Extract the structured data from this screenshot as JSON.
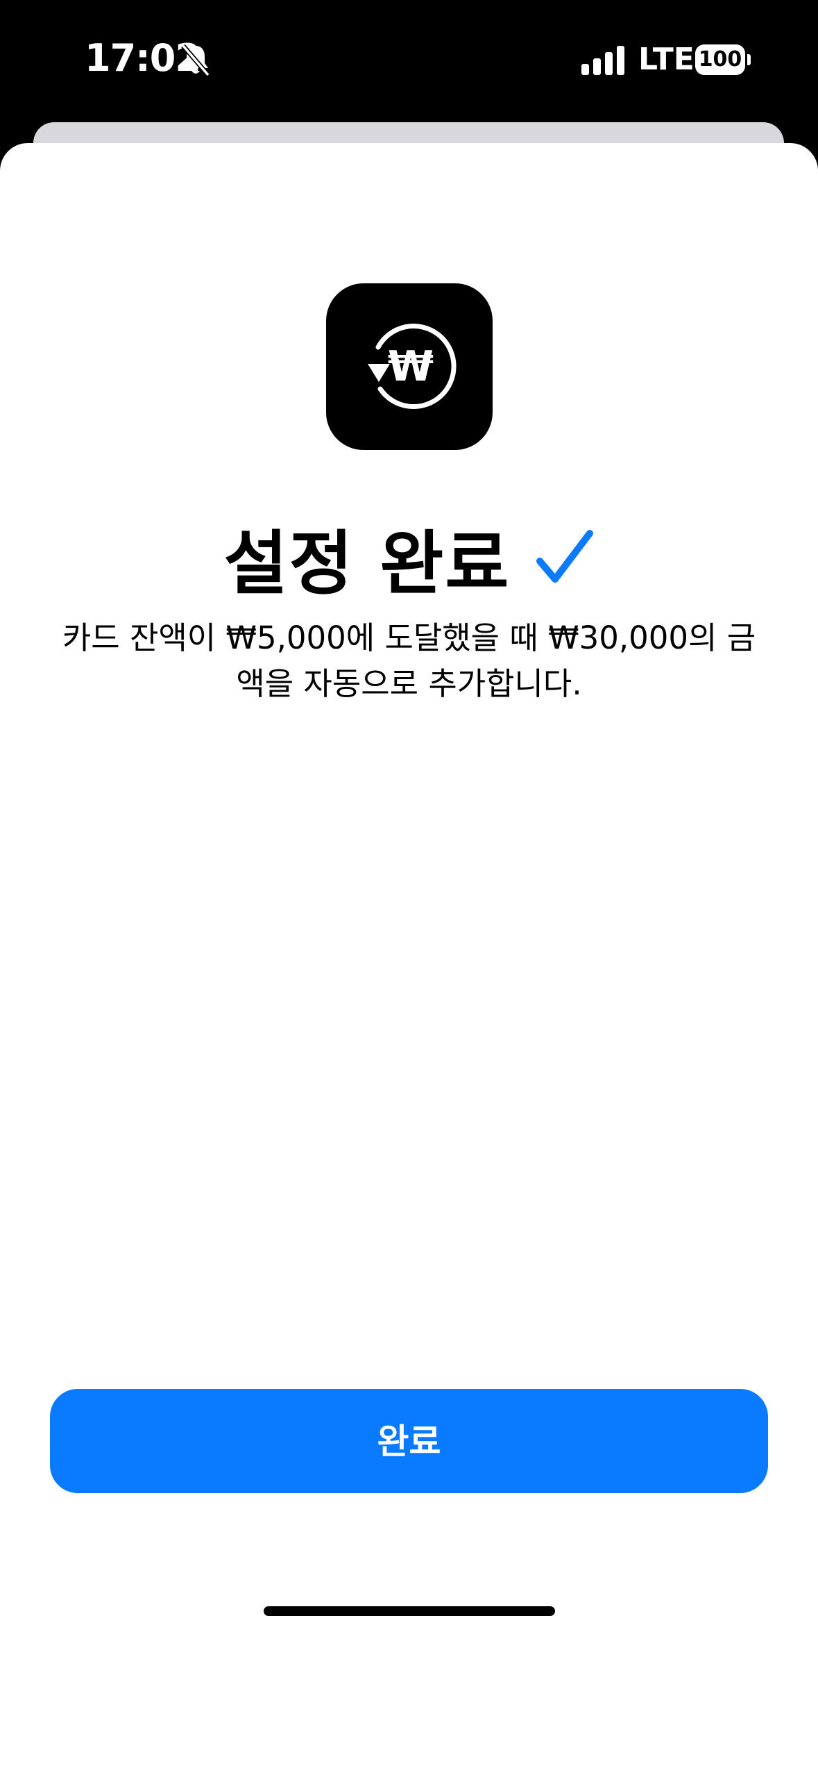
{
  "status_bar": {
    "time": "17:02",
    "network": "LTE",
    "battery": "100",
    "icons": [
      "bell-slash-icon",
      "signal-icon",
      "battery-icon"
    ]
  },
  "app_icon": {
    "icon": "won-refresh-icon",
    "symbol": "₩"
  },
  "title": "설정 완료",
  "description": "카드 잔액이 ₩5,000에 도달했을 때 ₩30,000의 금액을 자동으로 추가합니다.",
  "done_button": {
    "label": "완료"
  },
  "colors": {
    "accent": "#0a7aff",
    "background": "#ffffff",
    "status_bar": "#000000"
  }
}
